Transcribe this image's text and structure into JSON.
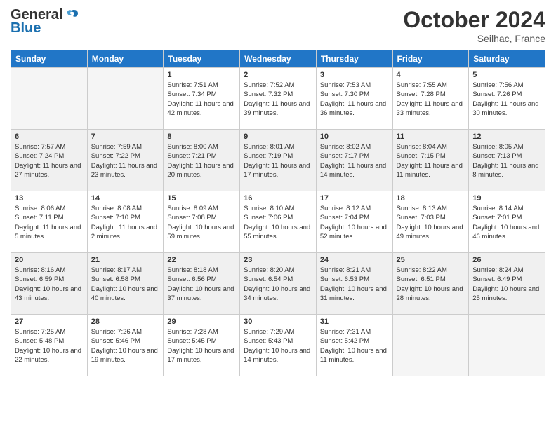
{
  "header": {
    "logo_general": "General",
    "logo_blue": "Blue",
    "month": "October 2024",
    "location": "Seilhac, France"
  },
  "days_of_week": [
    "Sunday",
    "Monday",
    "Tuesday",
    "Wednesday",
    "Thursday",
    "Friday",
    "Saturday"
  ],
  "weeks": [
    {
      "shaded": false,
      "days": [
        {
          "num": "",
          "empty": true
        },
        {
          "num": "",
          "empty": true
        },
        {
          "num": "1",
          "sunrise": "7:51 AM",
          "sunset": "7:34 PM",
          "daylight": "11 hours and 42 minutes."
        },
        {
          "num": "2",
          "sunrise": "7:52 AM",
          "sunset": "7:32 PM",
          "daylight": "11 hours and 39 minutes."
        },
        {
          "num": "3",
          "sunrise": "7:53 AM",
          "sunset": "7:30 PM",
          "daylight": "11 hours and 36 minutes."
        },
        {
          "num": "4",
          "sunrise": "7:55 AM",
          "sunset": "7:28 PM",
          "daylight": "11 hours and 33 minutes."
        },
        {
          "num": "5",
          "sunrise": "7:56 AM",
          "sunset": "7:26 PM",
          "daylight": "11 hours and 30 minutes."
        }
      ]
    },
    {
      "shaded": true,
      "days": [
        {
          "num": "6",
          "sunrise": "7:57 AM",
          "sunset": "7:24 PM",
          "daylight": "11 hours and 27 minutes."
        },
        {
          "num": "7",
          "sunrise": "7:59 AM",
          "sunset": "7:22 PM",
          "daylight": "11 hours and 23 minutes."
        },
        {
          "num": "8",
          "sunrise": "8:00 AM",
          "sunset": "7:21 PM",
          "daylight": "11 hours and 20 minutes."
        },
        {
          "num": "9",
          "sunrise": "8:01 AM",
          "sunset": "7:19 PM",
          "daylight": "11 hours and 17 minutes."
        },
        {
          "num": "10",
          "sunrise": "8:02 AM",
          "sunset": "7:17 PM",
          "daylight": "11 hours and 14 minutes."
        },
        {
          "num": "11",
          "sunrise": "8:04 AM",
          "sunset": "7:15 PM",
          "daylight": "11 hours and 11 minutes."
        },
        {
          "num": "12",
          "sunrise": "8:05 AM",
          "sunset": "7:13 PM",
          "daylight": "11 hours and 8 minutes."
        }
      ]
    },
    {
      "shaded": false,
      "days": [
        {
          "num": "13",
          "sunrise": "8:06 AM",
          "sunset": "7:11 PM",
          "daylight": "11 hours and 5 minutes."
        },
        {
          "num": "14",
          "sunrise": "8:08 AM",
          "sunset": "7:10 PM",
          "daylight": "11 hours and 2 minutes."
        },
        {
          "num": "15",
          "sunrise": "8:09 AM",
          "sunset": "7:08 PM",
          "daylight": "10 hours and 59 minutes."
        },
        {
          "num": "16",
          "sunrise": "8:10 AM",
          "sunset": "7:06 PM",
          "daylight": "10 hours and 55 minutes."
        },
        {
          "num": "17",
          "sunrise": "8:12 AM",
          "sunset": "7:04 PM",
          "daylight": "10 hours and 52 minutes."
        },
        {
          "num": "18",
          "sunrise": "8:13 AM",
          "sunset": "7:03 PM",
          "daylight": "10 hours and 49 minutes."
        },
        {
          "num": "19",
          "sunrise": "8:14 AM",
          "sunset": "7:01 PM",
          "daylight": "10 hours and 46 minutes."
        }
      ]
    },
    {
      "shaded": true,
      "days": [
        {
          "num": "20",
          "sunrise": "8:16 AM",
          "sunset": "6:59 PM",
          "daylight": "10 hours and 43 minutes."
        },
        {
          "num": "21",
          "sunrise": "8:17 AM",
          "sunset": "6:58 PM",
          "daylight": "10 hours and 40 minutes."
        },
        {
          "num": "22",
          "sunrise": "8:18 AM",
          "sunset": "6:56 PM",
          "daylight": "10 hours and 37 minutes."
        },
        {
          "num": "23",
          "sunrise": "8:20 AM",
          "sunset": "6:54 PM",
          "daylight": "10 hours and 34 minutes."
        },
        {
          "num": "24",
          "sunrise": "8:21 AM",
          "sunset": "6:53 PM",
          "daylight": "10 hours and 31 minutes."
        },
        {
          "num": "25",
          "sunrise": "8:22 AM",
          "sunset": "6:51 PM",
          "daylight": "10 hours and 28 minutes."
        },
        {
          "num": "26",
          "sunrise": "8:24 AM",
          "sunset": "6:49 PM",
          "daylight": "10 hours and 25 minutes."
        }
      ]
    },
    {
      "shaded": false,
      "days": [
        {
          "num": "27",
          "sunrise": "7:25 AM",
          "sunset": "5:48 PM",
          "daylight": "10 hours and 22 minutes."
        },
        {
          "num": "28",
          "sunrise": "7:26 AM",
          "sunset": "5:46 PM",
          "daylight": "10 hours and 19 minutes."
        },
        {
          "num": "29",
          "sunrise": "7:28 AM",
          "sunset": "5:45 PM",
          "daylight": "10 hours and 17 minutes."
        },
        {
          "num": "30",
          "sunrise": "7:29 AM",
          "sunset": "5:43 PM",
          "daylight": "10 hours and 14 minutes."
        },
        {
          "num": "31",
          "sunrise": "7:31 AM",
          "sunset": "5:42 PM",
          "daylight": "10 hours and 11 minutes."
        },
        {
          "num": "",
          "empty": true
        },
        {
          "num": "",
          "empty": true
        }
      ]
    }
  ],
  "labels": {
    "sunrise": "Sunrise:",
    "sunset": "Sunset:",
    "daylight": "Daylight:"
  }
}
